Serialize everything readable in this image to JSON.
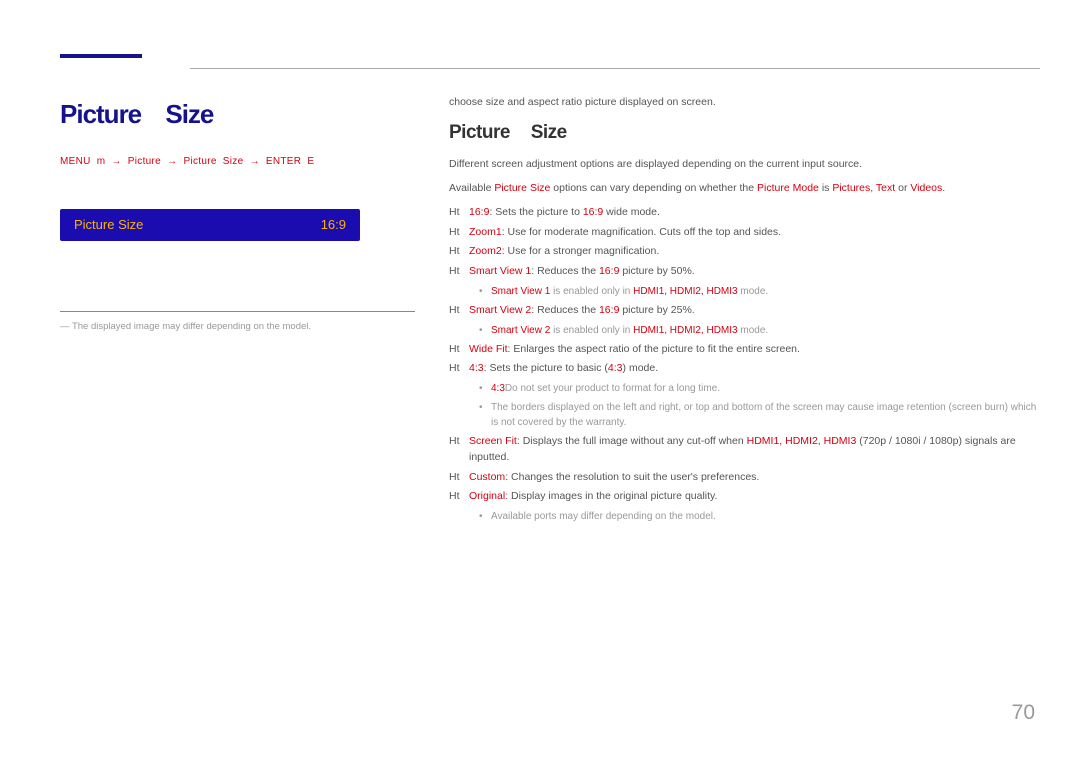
{
  "header": {
    "title_left": "Picture Size",
    "path": "MENU m → Picture → Picture Size → ENTER E",
    "setting_label": "Picture Size",
    "setting_value": "16:9",
    "note": "― The displayed image may differ depending on the model."
  },
  "right": {
    "intro": "choose size and aspect ratio picture displayed on screen.",
    "title": "Picture Size",
    "desc1": "Different screen adjustment options are displayed depending on the current input source.",
    "desc2_prefix": "Available ",
    "desc2_key1": "Picture Size",
    "desc2_mid": " options can vary depending on whether the ",
    "desc2_key2": "Picture Mode",
    "desc2_mid2": " is ",
    "desc2_key3": "Pictures",
    "desc2_mid3": ", ",
    "desc2_key4": "Text",
    "desc2_mid4": " or ",
    "desc2_key5": "Videos",
    "desc2_end": ".",
    "items": [
      {
        "pre": "Ht",
        "key": "16:9",
        "text": ": Sets the picture to ",
        "key2": "16:9",
        "text2": " wide mode."
      },
      {
        "pre": "Ht",
        "key": "Zoom1",
        "text": ": Use for moderate magnification. Cuts off the top and sides."
      },
      {
        "pre": "Ht",
        "key": "Zoom2",
        "text": ": Use for a stronger magnification."
      },
      {
        "pre": "Ht",
        "key": "Smart View 1",
        "text": ": Reduces the ",
        "key2": "16:9",
        "text2": " picture by 50%."
      },
      {
        "sub": true,
        "key": "Smart View 1",
        "text": " is enabled only in ",
        "key2": "HDMI1, HDMI2, HDMI3",
        "text2": " mode."
      },
      {
        "pre": "Ht",
        "key": "Smart View 2",
        "text": ": Reduces the ",
        "key2": "16:9",
        "text2": " picture by 25%."
      },
      {
        "sub": true,
        "key": "Smart View 2",
        "text": " is enabled only in ",
        "key2": "HDMI1, HDMI2, HDMI3",
        "text2": " mode."
      },
      {
        "pre": "Ht",
        "key": "Wide Fit",
        "text": ": Enlarges the aspect ratio of the picture to fit the entire screen."
      },
      {
        "pre": "Ht",
        "key": "4:3",
        "text": ": Sets the picture to basic (",
        "key2": "4:3",
        "text2": ") mode."
      },
      {
        "sub": true,
        "text": "Do not set your product to ",
        "key": "4:3",
        "text2": " format for a long time."
      },
      {
        "sub": true,
        "plain": "The borders displayed on the left and right, or top and bottom of the screen may cause image retention (screen burn) which is not covered by the warranty."
      },
      {
        "pre": "Ht",
        "key": "Screen Fit",
        "text": ": Displays the full image without any cut-off when ",
        "key2": "HDMI1, HDMI2, HDMI3",
        "text2": " (720p / 1080i / 1080p) signals are inputted."
      },
      {
        "pre": "Ht",
        "key": "Custom",
        "text": ": Changes the resolution to suit the user's preferences."
      },
      {
        "pre": "Ht",
        "key": "Original",
        "text": ": Display images in the original picture quality."
      },
      {
        "sub": true,
        "plain": "Available ports may differ depending on the model."
      }
    ]
  },
  "page_number": "70"
}
